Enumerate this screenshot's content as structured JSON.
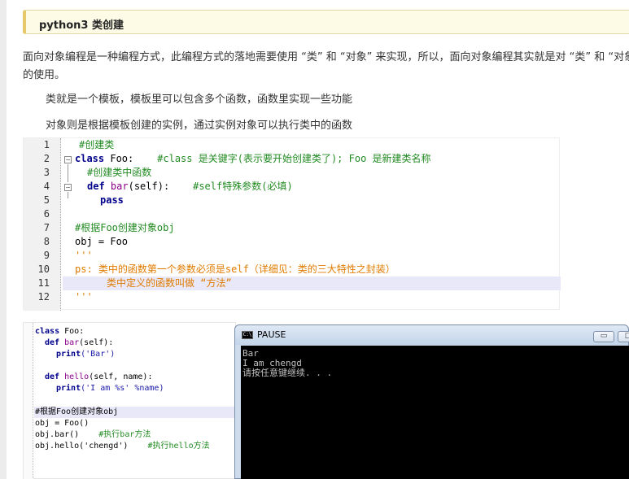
{
  "heading": {
    "title": "python3 类创建"
  },
  "intro": {
    "line1": "面向对象编程是一种编程方式，此编程方式的落地需要使用 “类” 和 “对象” 来实现，所以，面向对象编程其实就是对 “类” 和 “对象”",
    "line2": "的使用。",
    "class_desc": "类就是一个模板，模板里可以包含多个函数，函数里实现一些功能",
    "object_desc": "对象则是根据模板创建的实例，通过实例对象可以执行类中的函数"
  },
  "code_block_1": {
    "line_numbers": [
      "1",
      "2",
      "3",
      "4",
      "5",
      "6",
      "7",
      "8",
      "9",
      "10",
      "11",
      "12"
    ],
    "l1": "#创建类",
    "l2_kw": "class",
    "l2_name": " Foo:",
    "l2_comment": "#class 是关键字(表示要开始创建类了); Foo 是新建类名称",
    "l3": "#创建类中函数",
    "l4_kw": "def",
    "l4_fn": "bar",
    "l4_args": "(self):",
    "l4_comment": "#self特殊参数(必填)",
    "l5": "pass",
    "l7": "#根据Foo创建对象obj",
    "l8": "obj = Foo",
    "l9": "'''",
    "l10": "ps: 类中的函数第一个参数必须是self（详细见：类的三大特性之封装）",
    "l11": "类中定义的函数叫做 “方法”",
    "l12": "'''"
  },
  "code_block_2": {
    "l1_kw": "class",
    "l1_rest": " Foo:",
    "l2_kw": "def",
    "l2_fn": "bar",
    "l2_rest": "(self):",
    "l3_print": "print",
    "l3_str": "('Bar')",
    "l5_kw": "def",
    "l5_fn": "hello",
    "l5_rest": "(self, name):",
    "l6_print": "print",
    "l6_str": "('I am %s' %name)",
    "l8": "#根据Foo创建对象obj",
    "l9": "obj = Foo()",
    "l10_code": "obj.bar()",
    "l10_comment": "#执行bar方法",
    "l11_code": "obj.hello('chengd')",
    "l11_comment": "#执行hello方法"
  },
  "console_window": {
    "title": "PAUSE",
    "icon_text": "C:\\",
    "output": [
      "Bar",
      "I am chengd",
      "请按任意键继续. . ."
    ]
  }
}
